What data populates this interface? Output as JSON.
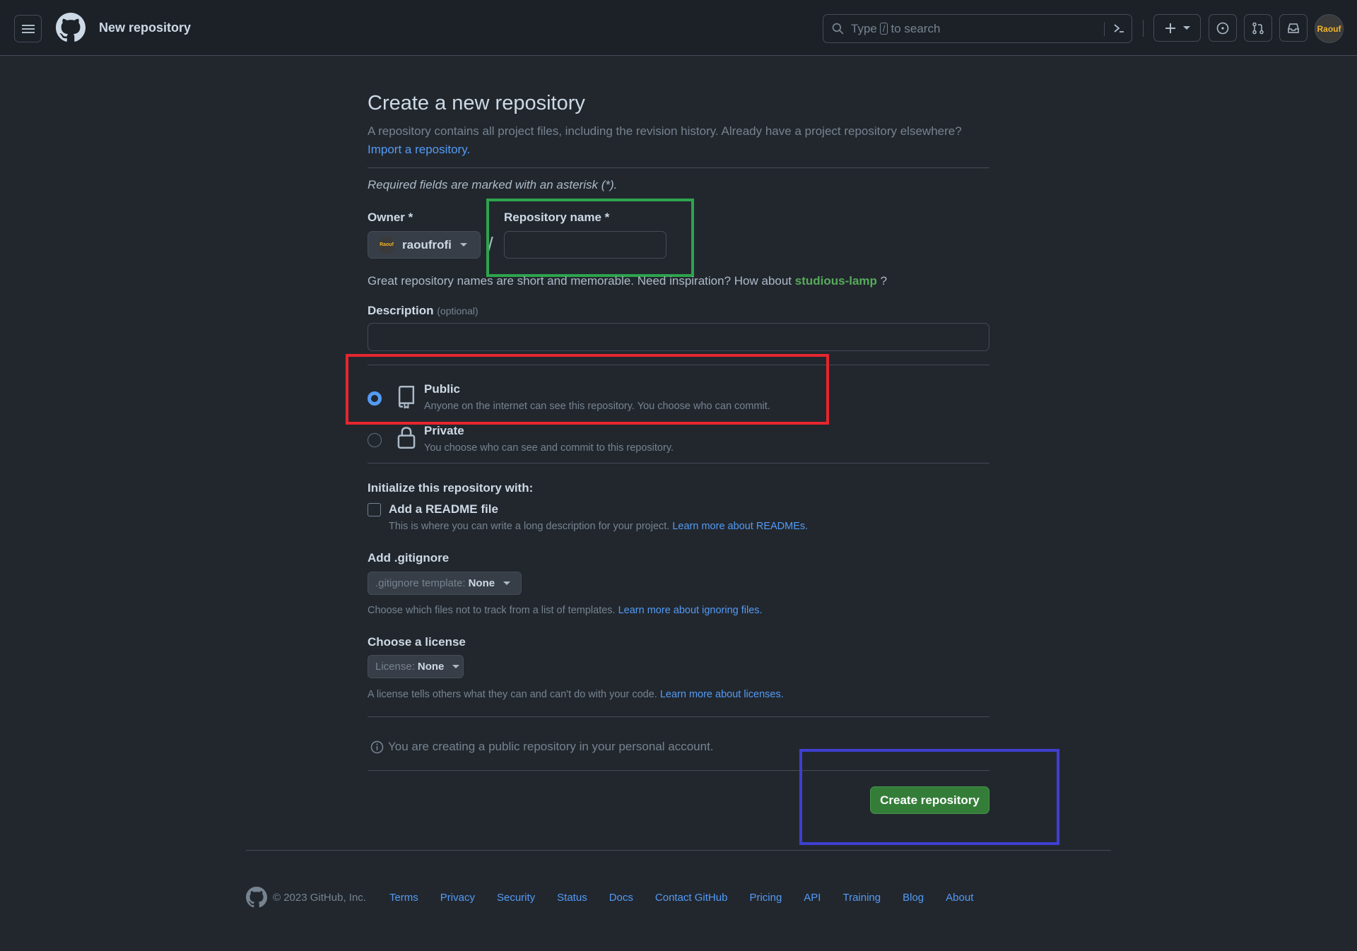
{
  "header": {
    "title": "New repository",
    "search": {
      "prefix": "Type",
      "key": "/",
      "suffix": "to search"
    }
  },
  "main": {
    "heading": "Create a new repository",
    "intro": "A repository contains all project files, including the revision history. Already have a project repository elsewhere?",
    "import_link": "Import a repository.",
    "required_note": "Required fields are marked with an asterisk (*).",
    "owner_label": "Owner *",
    "owner_value": "raoufrofi",
    "repo_name_label": "Repository name *",
    "repo_name_value": "",
    "suggest_prefix": "Great repository names are short and memorable. Need inspiration? How about",
    "suggest_name": "studious-lamp",
    "suggest_suffix": "?",
    "description_label": "Description",
    "description_optional": "(optional)",
    "description_value": "",
    "visibility": {
      "public_title": "Public",
      "public_desc": "Anyone on the internet can see this repository. You choose who can commit.",
      "private_title": "Private",
      "private_desc": "You choose who can see and commit to this repository.",
      "selected": "public"
    },
    "init_label": "Initialize this repository with:",
    "readme_label": "Add a README file",
    "readme_desc": "This is where you can write a long description for your project.",
    "readme_link": "Learn more about READMEs.",
    "readme_checked": false,
    "gitignore_label": "Add .gitignore",
    "gitignore_select_prefix": ".gitignore template:",
    "gitignore_select_value": "None",
    "gitignore_desc": "Choose which files not to track from a list of templates.",
    "gitignore_link": "Learn more about ignoring files.",
    "license_label": "Choose a license",
    "license_select_prefix": "License:",
    "license_select_value": "None",
    "license_desc": "A license tells others what they can and can't do with your code.",
    "license_link": "Learn more about licenses.",
    "info_text": "You are creating a public repository in your personal account.",
    "create_button": "Create repository"
  },
  "footer": {
    "copyright": "© 2023 GitHub, Inc.",
    "links": [
      "Terms",
      "Privacy",
      "Security",
      "Status",
      "Docs",
      "Contact GitHub",
      "Pricing",
      "API",
      "Training",
      "Blog",
      "About"
    ]
  },
  "colors": {
    "background": "#22272e",
    "header_bg": "#1c2128",
    "link": "#539bf5",
    "suggest_green": "#57ab5a",
    "create_button": "#347d39",
    "highlight_green": "#2da44e",
    "highlight_red": "#e5262e",
    "highlight_blue": "#3f3fd1"
  },
  "avatar_text": "Raouf"
}
